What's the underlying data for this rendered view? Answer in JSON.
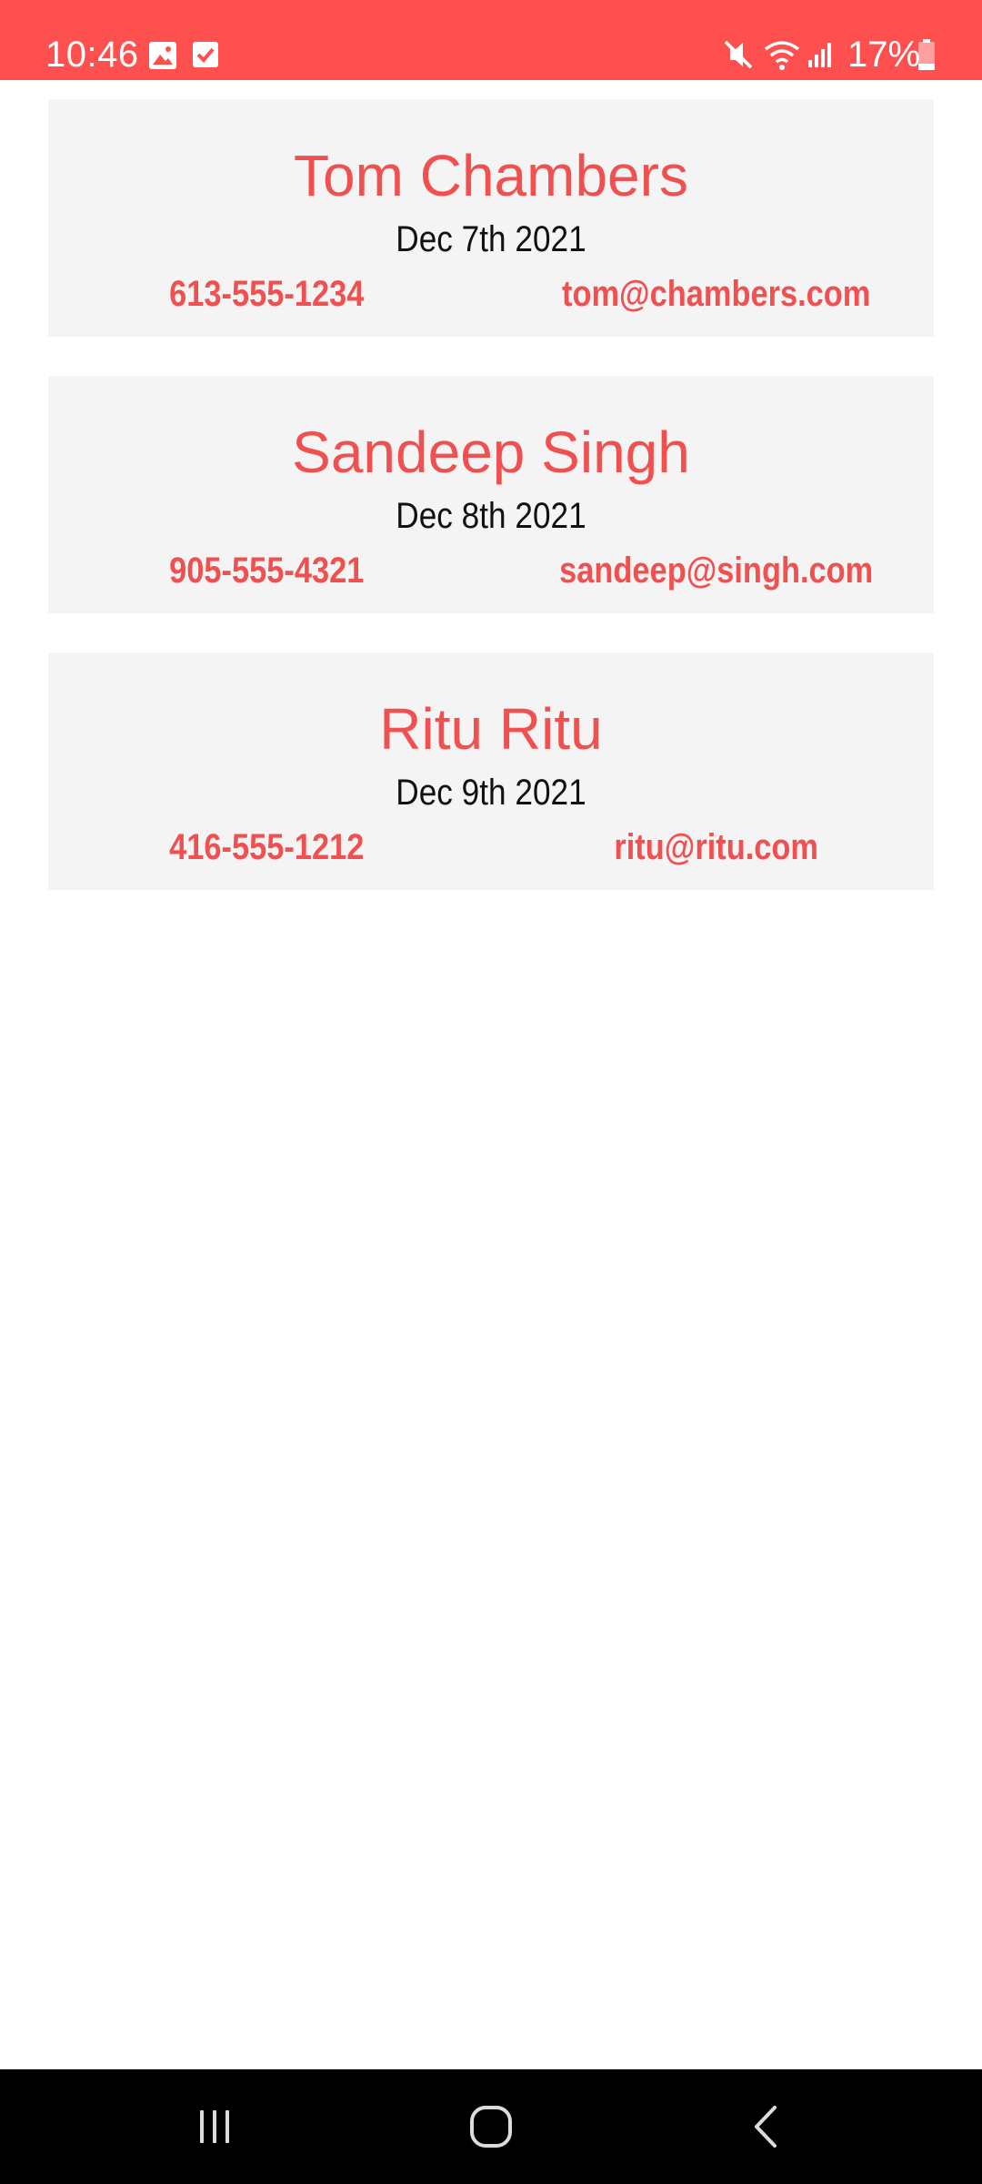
{
  "status_bar": {
    "time": "10:46",
    "battery": "17%",
    "background_color": "#ff5050",
    "icons": [
      "image-notification-icon",
      "checkbox-notification-icon",
      "mute-icon",
      "wifi-icon",
      "signal-icon",
      "battery-icon"
    ]
  },
  "contacts": [
    {
      "name": "Tom Chambers",
      "date": "Dec 7th 2021",
      "phone": "613-555-1234",
      "email": "tom@chambers.com"
    },
    {
      "name": "Sandeep Singh",
      "date": "Dec 8th 2021",
      "phone": "905-555-4321",
      "email": "sandeep@singh.com"
    },
    {
      "name": "Ritu Ritu",
      "date": "Dec 9th 2021",
      "phone": "416-555-1212",
      "email": "ritu@ritu.com"
    }
  ],
  "colors": {
    "accent": "#f0504f",
    "card_background": "#f4f4f4",
    "nav_background": "#000000"
  },
  "nav_bar": {
    "buttons": [
      "recent-apps-icon",
      "home-icon",
      "back-icon"
    ]
  }
}
